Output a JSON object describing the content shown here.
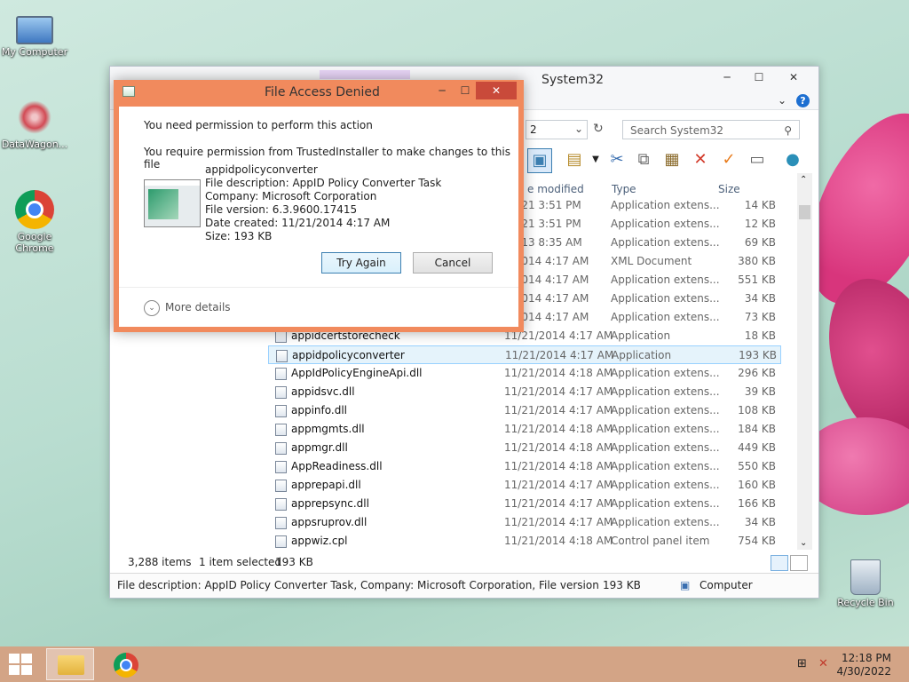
{
  "desktop": {
    "icons": [
      {
        "label": "My Computer"
      },
      {
        "label": "DataWagon..."
      },
      {
        "label": "Google Chrome"
      },
      {
        "label": "Recycle Bin"
      }
    ]
  },
  "explorer": {
    "title": "System32",
    "search_placeholder": "Search System32",
    "address_fragment": "2",
    "columns": {
      "date": "e modified",
      "type": "Type",
      "size": "Size"
    },
    "rows": [
      {
        "name": "",
        "date": "/2021 3:51 PM",
        "type": "Application extens...",
        "size": "14 KB"
      },
      {
        "name": "",
        "date": "/2021 3:51 PM",
        "type": "Application extens...",
        "size": "12 KB"
      },
      {
        "name": "",
        "date": "/2013 8:35 AM",
        "type": "Application extens...",
        "size": "69 KB"
      },
      {
        "name": "",
        "date": "1/2014 4:17 AM",
        "type": "XML Document",
        "size": "380 KB"
      },
      {
        "name": "",
        "date": "1/2014 4:17 AM",
        "type": "Application extens...",
        "size": "551 KB"
      },
      {
        "name": "",
        "date": "1/2014 4:17 AM",
        "type": "Application extens...",
        "size": "34 KB"
      },
      {
        "name": "",
        "date": "1/2014 4:17 AM",
        "type": "Application extens...",
        "size": "73 KB"
      },
      {
        "name": "appidcertstorecheck",
        "date": "11/21/2014 4:17 AM",
        "type": "Application",
        "size": "18 KB"
      },
      {
        "name": "appidpolicyconverter",
        "date": "11/21/2014 4:17 AM",
        "type": "Application",
        "size": "193 KB",
        "selected": true
      },
      {
        "name": "AppIdPolicyEngineApi.dll",
        "date": "11/21/2014 4:18 AM",
        "type": "Application extens...",
        "size": "296 KB"
      },
      {
        "name": "appidsvc.dll",
        "date": "11/21/2014 4:17 AM",
        "type": "Application extens...",
        "size": "39 KB"
      },
      {
        "name": "appinfo.dll",
        "date": "11/21/2014 4:17 AM",
        "type": "Application extens...",
        "size": "108 KB"
      },
      {
        "name": "appmgmts.dll",
        "date": "11/21/2014 4:18 AM",
        "type": "Application extens...",
        "size": "184 KB"
      },
      {
        "name": "appmgr.dll",
        "date": "11/21/2014 4:18 AM",
        "type": "Application extens...",
        "size": "449 KB"
      },
      {
        "name": "AppReadiness.dll",
        "date": "11/21/2014 4:18 AM",
        "type": "Application extens...",
        "size": "550 KB"
      },
      {
        "name": "apprepapi.dll",
        "date": "11/21/2014 4:17 AM",
        "type": "Application extens...",
        "size": "160 KB"
      },
      {
        "name": "apprepsync.dll",
        "date": "11/21/2014 4:17 AM",
        "type": "Application extens...",
        "size": "166 KB"
      },
      {
        "name": "appsruprov.dll",
        "date": "11/21/2014 4:17 AM",
        "type": "Application extens...",
        "size": "34 KB"
      },
      {
        "name": "appwiz.cpl",
        "date": "11/21/2014 4:18 AM",
        "type": "Control panel item",
        "size": "754 KB"
      }
    ],
    "status": {
      "items": "3,288 items",
      "selected": "1 item selected",
      "size": "193 KB"
    },
    "details": {
      "description": "File description: AppID Policy Converter Task, Company: Microsoft Corporation, File version: 6.3.9600.1",
      "size": "193 KB",
      "location": "Computer"
    }
  },
  "dialog": {
    "title": "File Access Denied",
    "line1": "You need permission to perform this action",
    "line2": "You require permission from TrustedInstaller to make changes to this file",
    "file_name": "appidpolicyconverter",
    "file_description": "File description: AppID Policy Converter Task",
    "company": "Company: Microsoft Corporation",
    "version": "File version: 6.3.9600.17415",
    "date_created": "Date created: 11/21/2014 4:17 AM",
    "size": "Size: 193 KB",
    "try_again": "Try Again",
    "cancel": "Cancel",
    "more_details": "More details"
  },
  "taskbar": {
    "time": "12:18 PM",
    "date": "4/30/2022"
  }
}
